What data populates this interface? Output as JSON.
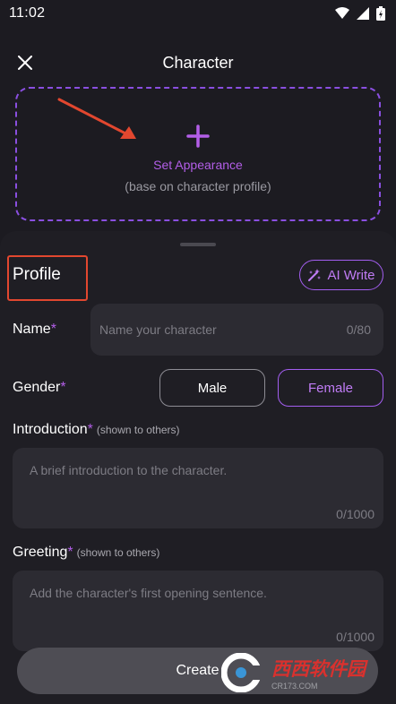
{
  "status_bar": {
    "time": "11:02"
  },
  "header": {
    "title": "Character"
  },
  "appearance": {
    "label": "Set Appearance",
    "sublabel": "(base on character profile)"
  },
  "profile": {
    "title": "Profile",
    "ai_write_label": "AI Write"
  },
  "name_field": {
    "label": "Name",
    "required_mark": "*",
    "placeholder": "Name your character",
    "counter": "0/80"
  },
  "gender_field": {
    "label": "Gender",
    "required_mark": "*",
    "options": [
      "Male",
      "Female"
    ],
    "selected": "Female"
  },
  "introduction_field": {
    "label": "Introduction",
    "required_mark": "*",
    "hint": "(shown to others)",
    "placeholder": "A brief introduction to the character.",
    "counter": "0/1000"
  },
  "greeting_field": {
    "label": "Greeting",
    "required_mark": "*",
    "hint": "(shown to others)",
    "placeholder": "Add the character's first opening sentence.",
    "counter": "0/1000"
  },
  "create_button": {
    "label": "Create"
  },
  "watermark": {
    "text": "西西软件园",
    "sub": "CR173.COM"
  },
  "colors": {
    "background": "#1c1b21",
    "accent": "#a35ef0",
    "highlight_box": "#e2472f",
    "arrow": "#e2472f"
  }
}
